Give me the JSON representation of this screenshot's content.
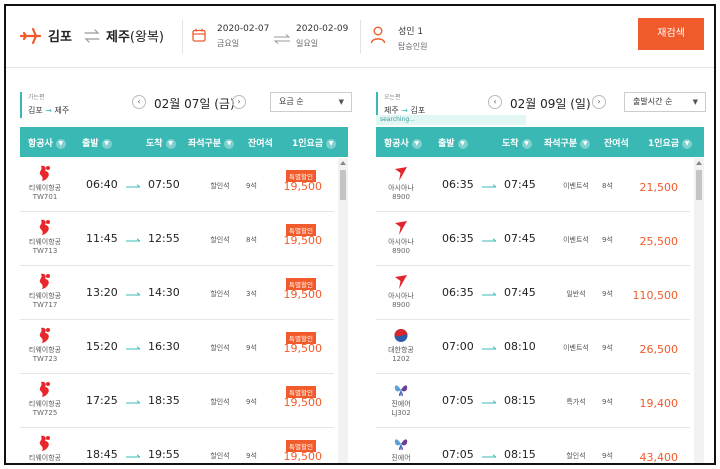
{
  "header": {
    "origin": "김포",
    "destination": "제주",
    "trip_type": "(왕복)",
    "depart_date": "2020-02-07",
    "depart_day": "금요일",
    "return_date": "2020-02-09",
    "return_day": "일요일",
    "passengers": "성인 1",
    "passengers_label": "탑승인원",
    "search_button": "재검색",
    "accent_color": "#f15a2b",
    "teal_color": "#3ab8b4"
  },
  "outbound": {
    "label": "가는편",
    "route_from": "김포",
    "route_to": "제주",
    "date": "02월 07일 (금)",
    "sort": "요금 순",
    "columns": [
      "항공사",
      "출발",
      "도착",
      "좌석구분",
      "잔여석",
      "1인요금"
    ],
    "flights": [
      {
        "airline": "티웨이항공",
        "code": "TW701",
        "dep": "06:40",
        "arr": "07:50",
        "seat": "할인석",
        "remaining": "9석",
        "badge": "특별할인",
        "price": "19,500"
      },
      {
        "airline": "티웨이항공",
        "code": "TW713",
        "dep": "11:45",
        "arr": "12:55",
        "seat": "할인석",
        "remaining": "8석",
        "badge": "특별할인",
        "price": "19,500"
      },
      {
        "airline": "티웨이항공",
        "code": "TW717",
        "dep": "13:20",
        "arr": "14:30",
        "seat": "할인석",
        "remaining": "3석",
        "badge": "특별할인",
        "price": "19,500"
      },
      {
        "airline": "티웨이항공",
        "code": "TW723",
        "dep": "15:20",
        "arr": "16:30",
        "seat": "할인석",
        "remaining": "9석",
        "badge": "특별할인",
        "price": "19,500"
      },
      {
        "airline": "티웨이항공",
        "code": "TW725",
        "dep": "17:25",
        "arr": "18:35",
        "seat": "할인석",
        "remaining": "9석",
        "badge": "특별할인",
        "price": "19,500"
      },
      {
        "airline": "티웨이항공",
        "code": "",
        "dep": "18:45",
        "arr": "19:55",
        "seat": "할인석",
        "remaining": "9석",
        "badge": "특별할인",
        "price": "19,500"
      }
    ]
  },
  "inbound": {
    "label": "오는편",
    "route_from": "제주",
    "route_to": "김포",
    "date": "02월 09일 (일)",
    "sort": "출발시간 순",
    "status": "searching...",
    "columns": [
      "항공사",
      "출발",
      "도착",
      "좌석구분",
      "잔여석",
      "1인요금"
    ],
    "flights": [
      {
        "airline": "아시아나",
        "code": "8900",
        "dep": "06:35",
        "arr": "07:45",
        "seat": "이벤트석",
        "remaining": "8석",
        "price": "21,500",
        "logo": "asiana"
      },
      {
        "airline": "아시아나",
        "code": "8900",
        "dep": "06:35",
        "arr": "07:45",
        "seat": "이벤트석",
        "remaining": "9석",
        "price": "25,500",
        "logo": "asiana"
      },
      {
        "airline": "아시아나",
        "code": "8900",
        "dep": "06:35",
        "arr": "07:45",
        "seat": "일반석",
        "remaining": "9석",
        "price": "110,500",
        "logo": "asiana"
      },
      {
        "airline": "대한항공",
        "code": "1202",
        "dep": "07:00",
        "arr": "08:10",
        "seat": "이벤트석",
        "remaining": "9석",
        "price": "26,500",
        "logo": "korean"
      },
      {
        "airline": "진에어",
        "code": "LJ302",
        "dep": "07:05",
        "arr": "08:15",
        "seat": "특가석",
        "remaining": "9석",
        "price": "19,400",
        "logo": "jinair"
      },
      {
        "airline": "진에어",
        "code": "",
        "dep": "07:05",
        "arr": "08:15",
        "seat": "할인석",
        "remaining": "9석",
        "price": "43,400",
        "logo": "jinair"
      }
    ]
  }
}
